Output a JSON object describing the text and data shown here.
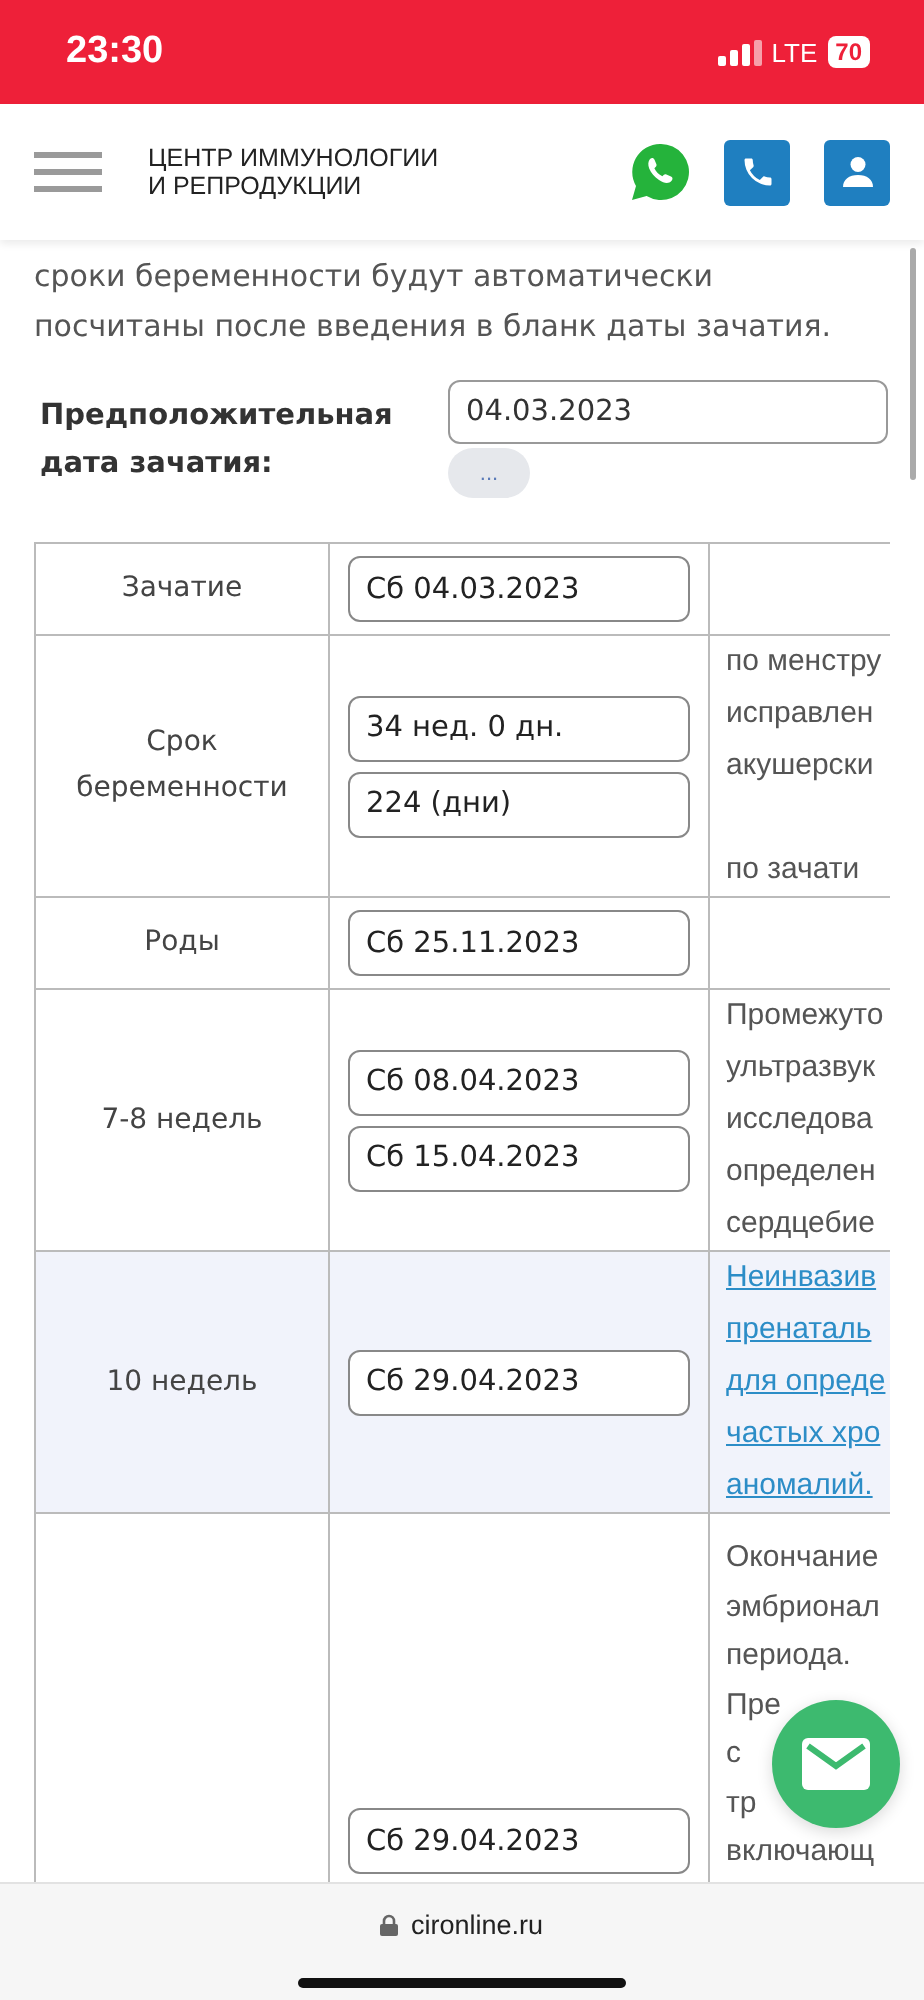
{
  "status_bar": {
    "time": "23:30",
    "network": "LTE",
    "battery": "70"
  },
  "header": {
    "logo_lines": [
      "ЦЕНТР ИММУНОЛОГИИ",
      "И РЕПРОДУКЦИИ"
    ]
  },
  "intro": "сроки беременности будут автоматически посчитаны после введения в бланк даты зачатия.",
  "conception_field": {
    "label": "Предположительная дата зачатия:",
    "value": "04.03.2023",
    "button": "..."
  },
  "table": {
    "rows": [
      {
        "label": "Зачатие",
        "highlighted": false,
        "dates": [
          "Сб 04.03.2023"
        ],
        "notes": []
      },
      {
        "label": "Срок беременности",
        "highlighted": false,
        "dates": [
          "34 нед. 0 дн.",
          "224 (дни)"
        ],
        "notes": [
          {
            "kind": "text",
            "lines": [
              "по менстру",
              "исправлен",
              "акушерски"
            ]
          },
          {
            "kind": "text",
            "lines": [
              "по зачати"
            ]
          }
        ]
      },
      {
        "label": "Роды",
        "highlighted": false,
        "dates": [
          "Сб 25.11.2023"
        ],
        "notes": []
      },
      {
        "label": "7-8 недель",
        "highlighted": false,
        "dates": [
          "Сб 08.04.2023",
          "Сб 15.04.2023"
        ],
        "notes": [
          {
            "kind": "text",
            "lines": [
              "Промежуто",
              "ультразвук",
              "исследова",
              "определен",
              "сердцебие"
            ]
          }
        ]
      },
      {
        "label": "10 недель",
        "highlighted": true,
        "dates": [
          "Сб 29.04.2023"
        ],
        "notes": [
          {
            "kind": "link",
            "lines": [
              "Неинвазив",
              "пренаталь",
              "для опреде",
              "частых хро",
              "аномалий."
            ]
          }
        ]
      },
      {
        "label": "",
        "highlighted": false,
        "dates": [
          "Сб 29.04.2023"
        ],
        "notes": [
          {
            "kind": "text",
            "lines": [
              "Окончание",
              "эмбрионал",
              "периода.",
              "Пре",
              "с",
              "тр",
              "включающ"
            ]
          }
        ]
      }
    ]
  },
  "browser_bar": {
    "url": "cironline.ru"
  }
}
